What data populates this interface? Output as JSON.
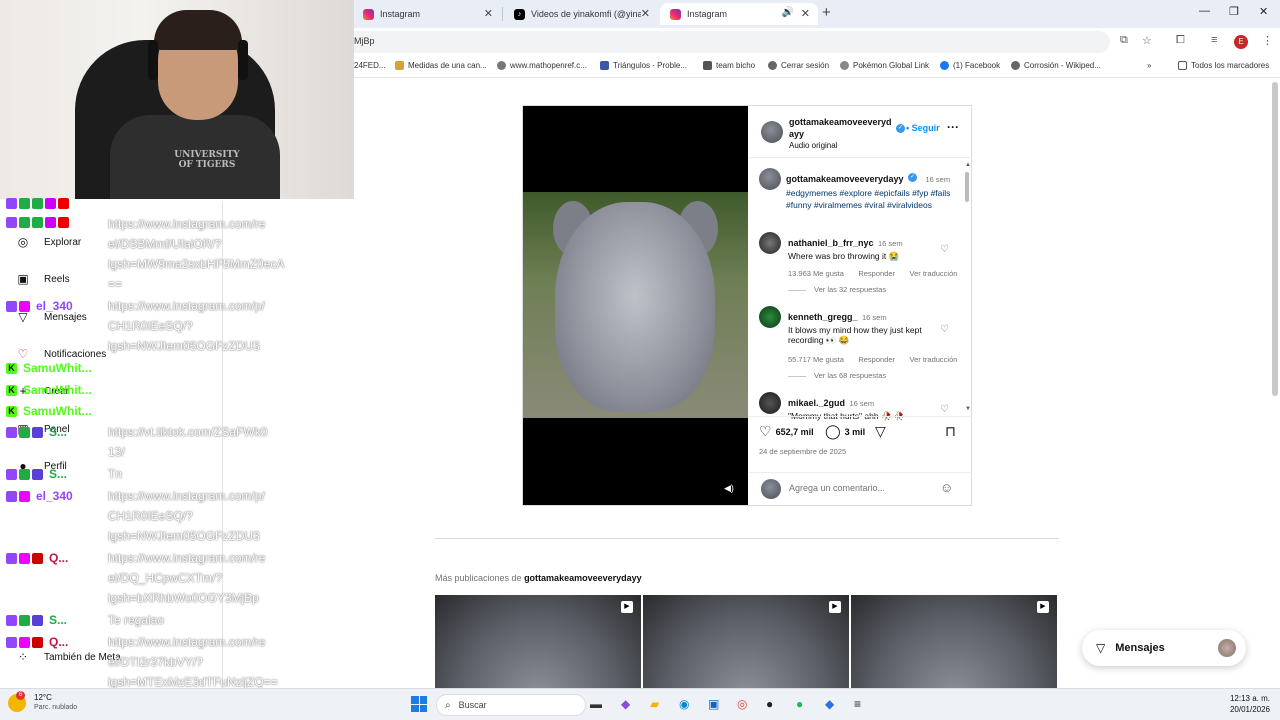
{
  "browser": {
    "tabs": [
      {
        "label": "Instagram",
        "icon": "instagram-icon",
        "active": false
      },
      {
        "label": "Videos de yinakomfi (@yinakom",
        "icon": "tiktok-icon",
        "active": false
      },
      {
        "label": "Instagram",
        "icon": "instagram-icon",
        "active": true
      }
    ],
    "address": "MjBp",
    "profile_initial": "E",
    "bookmarks": [
      "24FED...",
      "Medidas de una can...",
      "www.mathopenref.c...",
      "Triángulos - Proble...",
      "team bicho",
      "Cerrar sesión",
      "Pokémon Global Link",
      "(1) Facebook",
      "Corrosión - Wikiped..."
    ],
    "all_bookmarks": "Todos los marcadores"
  },
  "webcam": {
    "shirt_text": "UNIVERSITY OF TIGERS"
  },
  "ig_nav": {
    "explore": "Explorar",
    "reels": "Reels",
    "messages": "Mensajes",
    "notifications": "Notificaciones",
    "create": "Crear",
    "panel": "Panel",
    "profile": "Perfil",
    "meta": "También de Meta"
  },
  "chat": {
    "users": {
      "el340": "el_340",
      "samu": "SamuWhit...",
      "s": "S...",
      "q": "Q..."
    },
    "messages": [
      "https://www.instagram.com/re\nel/DSBMmf/UfaiOR/?\nigsh=MW9ma2sxbHF5MmZ0ecA\n==",
      "https://www.instagram.com/p/\nCH1R0IEeSQ/?\nigsh=NWJIem05OGFzZDU3",
      "https://vt.tiktok.com/ZSaFWk0\n13/",
      "Tn",
      "https://www.instagram.com/p/\nCH1R0IEeSQ/?\nigsh=NWJIem05OGFzZDU3",
      "https://www.instagram.com/re\nel/DQ_HCpwCXTm/?\nigsh=bXRhbWo0OGY3MjBp",
      "Te regalao",
      "https://www.instagram.com/re\nel/DTI2r37kbVY/?\nigsh=MTExMzE3dTFuNzljZQ=="
    ]
  },
  "post": {
    "author": "gottamakeamoveeverydayy",
    "author_wrapped": "gottamakeamoveeveryd\nayy",
    "follow": "Seguir",
    "audio": "Audio original",
    "caption_time": "16 sem",
    "caption_tags": "#edgymemes #explore #epicfails #fyp #fails #funny #viralmemes #viral #viralvideos",
    "comments": [
      {
        "user": "nathaniel_b_frr_nyc",
        "time": "16 sem",
        "text": "Where was bro throwing it 😭",
        "likes": "13.963 Me gusta",
        "reply": "Responder",
        "translate": "Ver traducción",
        "replies": "Ver las 32 respuestas"
      },
      {
        "user": "kenneth_gregg_",
        "time": "16 sem",
        "text": "It blows my mind how they just kept recording 👀 😂",
        "likes": "55.717 Me gusta",
        "reply": "Responder",
        "translate": "Ver traducción",
        "replies": "Ver las 68 respuestas"
      },
      {
        "user": "mikael._2gud",
        "time": "16 sem",
        "text": "\"Mommy that hurts\" ahh 🥀 🥀"
      }
    ],
    "likes": "652,7 mil",
    "comment_count": "3 mil",
    "date": "24 de septiembre de 2025",
    "comment_placeholder": "Agrega un comentario..."
  },
  "more_posts": {
    "prefix": "Más publicaciones de ",
    "user": "gottamakeamoveeverydayy"
  },
  "messages_button": "Mensajes",
  "taskbar": {
    "temp": "12°C",
    "weather": "Parc. nublado",
    "weather_badge": "6",
    "search": "Buscar",
    "time": "12:13 a. m.",
    "date": "20/01/2026"
  },
  "colors": {
    "ig_blue": "#0095f6",
    "link_blue": "#00376b",
    "twitch": "#9146ff",
    "kick": "#53fc18"
  }
}
